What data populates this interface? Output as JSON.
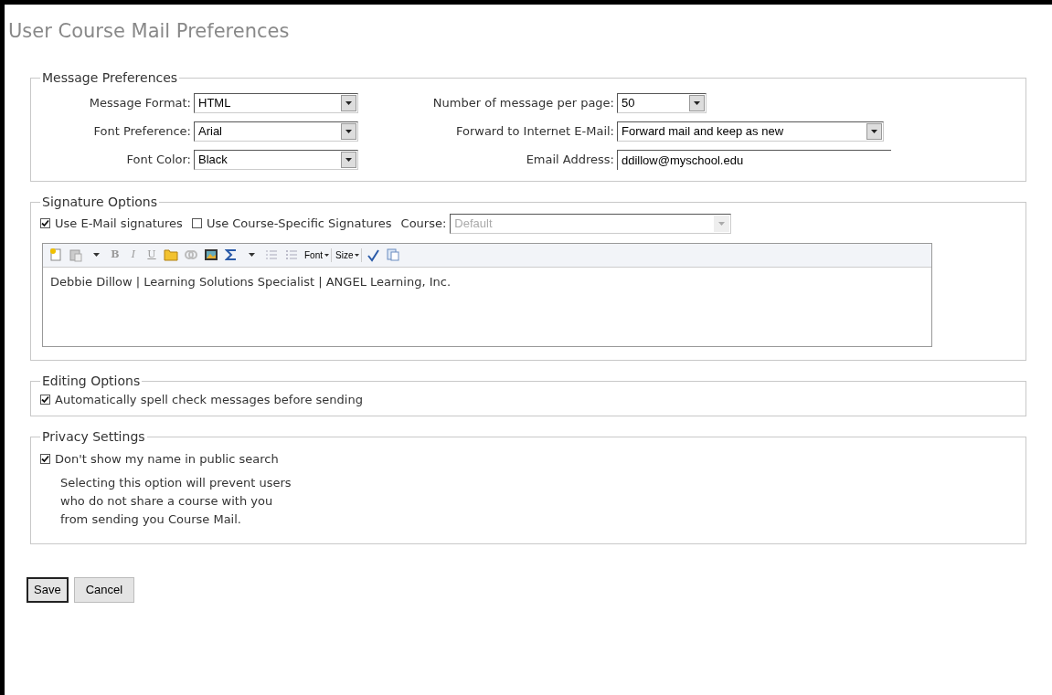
{
  "title": "User Course Mail Preferences",
  "message_preferences": {
    "legend": "Message Preferences",
    "left": [
      {
        "label": "Message Format:",
        "value": "HTML"
      },
      {
        "label": "Font Preference:",
        "value": "Arial"
      },
      {
        "label": "Font Color:",
        "value": "Black"
      }
    ],
    "per_page": {
      "label": "Number of message per page:",
      "value": "50"
    },
    "forward": {
      "label": "Forward to Internet E-Mail:",
      "value": "Forward mail and keep as new"
    },
    "email": {
      "label": "Email Address:",
      "value": "ddillow@myschool.edu"
    }
  },
  "signature_options": {
    "legend": "Signature Options",
    "use_signatures": {
      "label": "Use E-Mail signatures",
      "checked": true
    },
    "course_specific": {
      "label": "Use Course-Specific Signatures",
      "checked": false
    },
    "course": {
      "label": "Course:",
      "value": "Default",
      "disabled": true
    },
    "toolbar": {
      "bold": "B",
      "italic": "I",
      "underline": "U",
      "font": "Font",
      "size": "Size"
    },
    "signature_text": "Debbie Dillow | Learning Solutions Specialist | ANGEL Learning, Inc."
  },
  "editing_options": {
    "legend": "Editing Options",
    "spell_check": {
      "label": "Automatically spell check messages before sending",
      "checked": true
    }
  },
  "privacy_settings": {
    "legend": "Privacy Settings",
    "hide_name": {
      "label": "Don't show my name in public search",
      "checked": true
    },
    "note_lines": [
      "Selecting this option will prevent users",
      "who do not share a course with you",
      "from sending you Course Mail."
    ]
  },
  "buttons": [
    {
      "label": "Save",
      "selected": true
    },
    {
      "label": "Cancel",
      "selected": false
    }
  ]
}
